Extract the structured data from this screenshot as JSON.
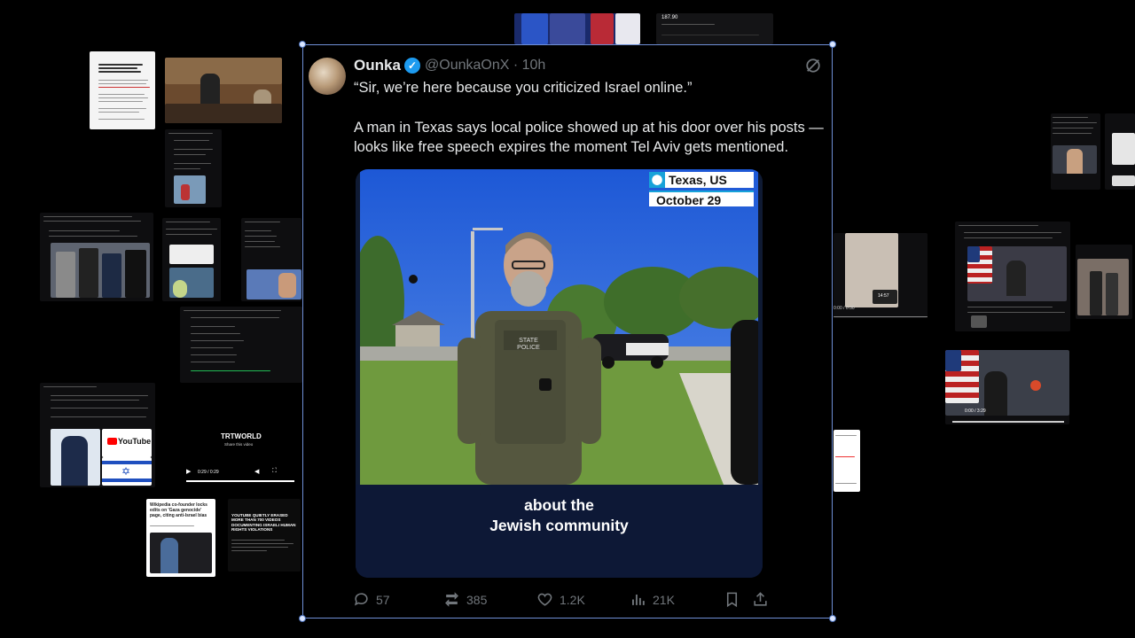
{
  "tweet": {
    "display_name": "Ounka",
    "handle": "@OunkaOnX",
    "time": "· 10h",
    "text_lines": [
      "“Sir, we’re here because you criticized Israel online.”",
      "A man in Texas says local police showed up at his door over his posts —",
      "looks like free speech expires the moment Tel Aviv gets mentioned."
    ],
    "video": {
      "location_badge": "Texas, US",
      "date_badge": "October 29",
      "vest_label": "STATE POLICE",
      "caption_line1": "about the",
      "caption_line2": "Jewish community"
    },
    "actions": {
      "replies": "57",
      "reposts": "385",
      "likes": "1.2K",
      "views": "21K"
    }
  },
  "background": {
    "top_chart_price": "187.90",
    "article_wikipedia_headline": "Wikipedia co-founder locks edits on 'Gaza genocide' page, citing anti-Israel bias",
    "article_intercept_headline": "YOUTUBE QUIETLY ERASED MORE THAN 700 VIDEOS DOCUMENTING ISRAELI HUMAN RIGHTS VIOLATIONS",
    "trtworld_logo": "TRTWORLD",
    "trtworld_share": "Share this video",
    "video_player_time": "0:29 / 0:29",
    "youtube_label": "YouTube",
    "right_player_time": "0:00 / 3:29",
    "right_player_time_small": "0:00 / 0:30",
    "right_player_time_small2": "14:57"
  },
  "colors": {
    "selection_border": "#6f8fd6",
    "verified_blue": "#1d9bf0",
    "muted_text": "#71767b",
    "caption_band": "#0d1836"
  }
}
